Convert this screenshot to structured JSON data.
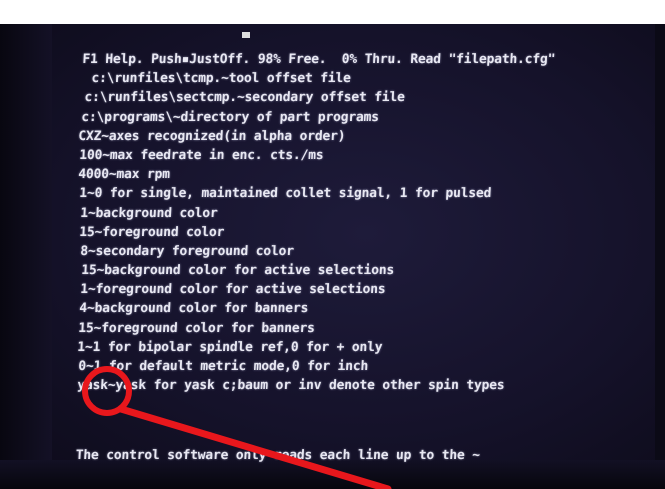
{
  "screen": {
    "lines": [
      "F1 Help. Push▪JustOff. 98% Free.  0% Thru. Read \"filepath.cfg\"",
      "c:\\runfiles\\tcmp.~tool offset file",
      "c:\\runfiles\\sectcmp.~secondary offset file",
      "c:\\programs\\~directory of part programs",
      "CXZ~axes recognized(in alpha order)",
      "100~max feedrate in enc. cts./ms",
      "4000~max rpm",
      "1~0 for single, maintained collet signal, 1 for pulsed",
      "1~background color",
      "15~foreground color",
      "8~secondary foreground color",
      "15~background color for active selections",
      "1~foreground color for active selections",
      "4~background color for banners",
      "15~foreground color for banners",
      "1~1 for bipolar spindle ref,0 for + only",
      "0~1 for default metric mode,0 for inch",
      "yask~yask for yask c;baum or inv denote other spin types",
      "",
      "",
      "The control software only reads each line up to the ~"
    ]
  },
  "annotation": {
    "color": "#e8171c",
    "shapes": [
      "highlight-circle",
      "pointer-arrow"
    ]
  }
}
